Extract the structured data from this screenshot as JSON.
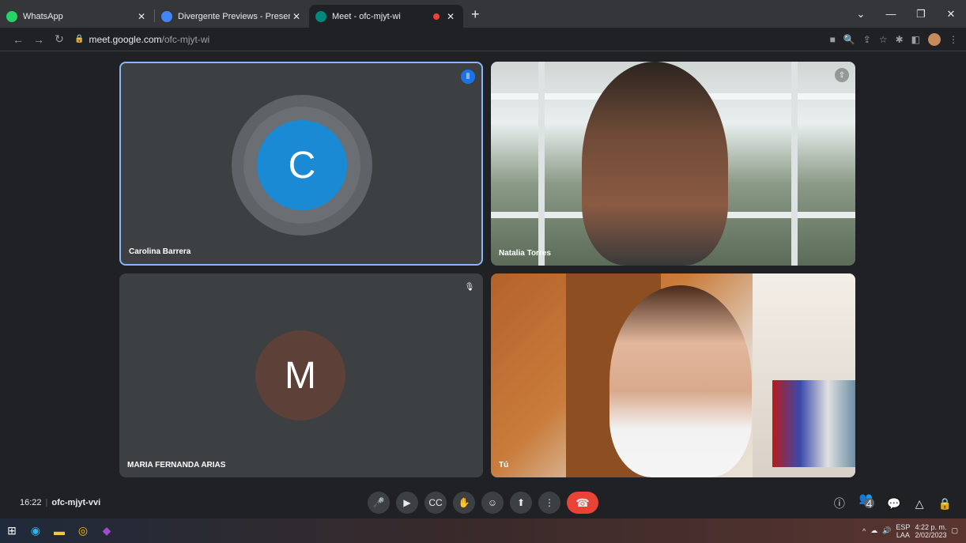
{
  "browser": {
    "tabs": [
      {
        "title": "WhatsApp",
        "favicon_color": "#25d366",
        "active": false
      },
      {
        "title": "Divergente Previews - Presentaci",
        "favicon_color": "#4285f4",
        "active": false
      },
      {
        "title": "Meet - ofc-mjyt-wi",
        "favicon_color": "#00897b",
        "active": true
      }
    ],
    "address": {
      "host": "meet.google.com",
      "path": "/ofc-mjyt-wi"
    }
  },
  "meet": {
    "participants": [
      {
        "name": "Carolina Barrera",
        "initial": "C",
        "avatar_color": "#1a8ad4",
        "speaking": true
      },
      {
        "name": "Natalia Torres",
        "video": true
      },
      {
        "name": "MARIA FERNANDA ARIAS",
        "initial": "M",
        "avatar_color": "#5d4037",
        "muted": true
      },
      {
        "name": "Tú",
        "video": true
      }
    ],
    "time": "16:22",
    "code": "ofc-mjyt-vvi",
    "people_count": "4",
    "accent": "#8ab4f8",
    "end_call_color": "#ea4335"
  },
  "taskbar": {
    "language": "ESP",
    "region": "LAA",
    "clock_time": "4:22 p. m.",
    "clock_date": "2/02/2023"
  }
}
